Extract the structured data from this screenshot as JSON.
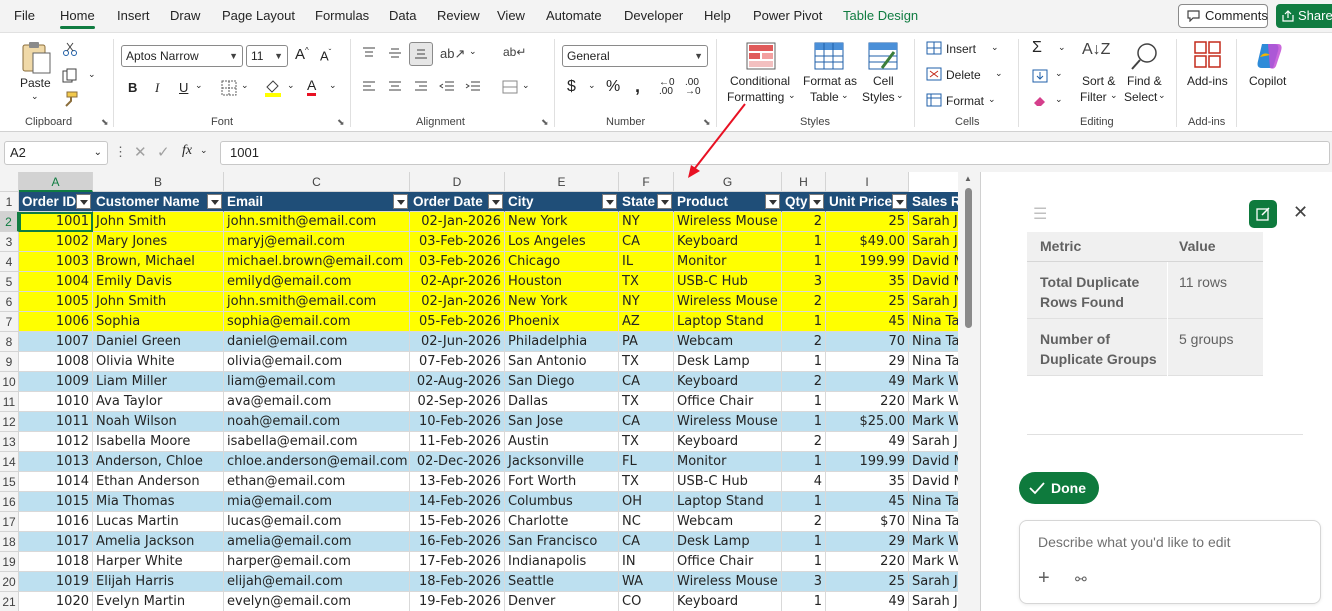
{
  "menu": {
    "items": [
      "File",
      "Home",
      "Insert",
      "Draw",
      "Page Layout",
      "Formulas",
      "Data",
      "Review",
      "View",
      "Automate",
      "Developer",
      "Help",
      "Power Pivot",
      "Table Design"
    ],
    "active": "Home",
    "comments_label": "Comments",
    "share_label": "Share"
  },
  "ribbon": {
    "paste_label": "Paste",
    "font_name": "Aptos Narrow",
    "font_size": "11",
    "number_format": "General",
    "conditional_formatting_line1": "Conditional",
    "conditional_formatting_line2": "Formatting",
    "format_as_table_line1": "Format as",
    "format_as_table_line2": "Table",
    "cell_styles_line1": "Cell",
    "cell_styles_line2": "Styles",
    "insert_label": "Insert",
    "delete_label": "Delete",
    "format_label": "Format",
    "sort_filter_line1": "Sort &",
    "sort_filter_line2": "Filter",
    "find_select_line1": "Find &",
    "find_select_line2": "Select",
    "addins_label": "Add-ins",
    "copilot_label": "Copilot",
    "groups": {
      "clipboard": "Clipboard",
      "font": "Font",
      "alignment": "Alignment",
      "number": "Number",
      "styles": "Styles",
      "cells": "Cells",
      "editing": "Editing",
      "addins": "Add-ins"
    }
  },
  "formula_bar": {
    "name_box": "A2",
    "fx_label": "fx",
    "value": "1001"
  },
  "sheet": {
    "columns": [
      "A",
      "B",
      "C",
      "D",
      "E",
      "F",
      "G",
      "H",
      "I"
    ],
    "headers": [
      "Order ID",
      "Customer Name",
      "Email",
      "Order Date",
      "City",
      "State",
      "Product",
      "Qty",
      "Unit Price",
      "Sales Rep"
    ],
    "rows": [
      [
        "1001",
        "John Smith",
        "john.smith@email.com",
        "02-Jan-2026",
        "New York",
        "NY",
        "Wireless Mouse",
        "2",
        "25",
        "Sarah J"
      ],
      [
        "1002",
        "Mary Jones",
        "maryj@email.com",
        "03-Feb-2026",
        "Los Angeles",
        "CA",
        "Keyboard",
        "1",
        "$49.00",
        "Sarah J"
      ],
      [
        "1003",
        "Brown, Michael",
        "michael.brown@email.com",
        "03-Feb-2026",
        "Chicago",
        "IL",
        "Monitor",
        "1",
        "199.99",
        "David M"
      ],
      [
        "1004",
        "Emily Davis",
        "emilyd@email.com",
        "02-Apr-2026",
        "Houston",
        "TX",
        "USB-C Hub",
        "3",
        "35",
        "David M"
      ],
      [
        "1005",
        "John Smith",
        "john.smith@email.com",
        "02-Jan-2026",
        "New York",
        "NY",
        "Wireless Mouse",
        "2",
        "25",
        "Sarah J"
      ],
      [
        "1006",
        "Sophia",
        "sophia@email.com",
        "05-Feb-2026",
        "Phoenix",
        "AZ",
        "Laptop Stand",
        "1",
        "45",
        "Nina Ta"
      ],
      [
        "1007",
        "Daniel Green",
        "daniel@email.com",
        "02-Jun-2026",
        "Philadelphia",
        "PA",
        "Webcam",
        "2",
        "70",
        "Nina Ta"
      ],
      [
        "1008",
        "Olivia White",
        "olivia@email.com",
        "07-Feb-2026",
        "San Antonio",
        "TX",
        "Desk Lamp",
        "1",
        "29",
        "Nina Ta"
      ],
      [
        "1009",
        "Liam Miller",
        "liam@email.com",
        "02-Aug-2026",
        "San Diego",
        "CA",
        "Keyboard",
        "2",
        "49",
        "Mark W"
      ],
      [
        "1010",
        "Ava Taylor",
        "ava@email.com",
        "02-Sep-2026",
        "Dallas",
        "TX",
        "Office Chair",
        "1",
        "220",
        "Mark W"
      ],
      [
        "1011",
        "Noah Wilson",
        "noah@email.com",
        "10-Feb-2026",
        "San Jose",
        "CA",
        "Wireless Mouse",
        "1",
        "$25.00",
        "Mark W"
      ],
      [
        "1012",
        "Isabella Moore",
        "isabella@email.com",
        "11-Feb-2026",
        "Austin",
        "TX",
        "Keyboard",
        "2",
        "49",
        "Sarah J"
      ],
      [
        "1013",
        "Anderson, Chloe",
        "chloe.anderson@email.com",
        "02-Dec-2026",
        "Jacksonville",
        "FL",
        "Monitor",
        "1",
        "199.99",
        "David M"
      ],
      [
        "1014",
        "Ethan Anderson",
        "ethan@email.com",
        "13-Feb-2026",
        "Fort Worth",
        "TX",
        "USB-C Hub",
        "4",
        "35",
        "David M"
      ],
      [
        "1015",
        "Mia Thomas",
        "mia@email.com",
        "14-Feb-2026",
        "Columbus",
        "OH",
        "Laptop Stand",
        "1",
        "45",
        "Nina Ta"
      ],
      [
        "1016",
        "Lucas Martin",
        "lucas@email.com",
        "15-Feb-2026",
        "Charlotte",
        "NC",
        "Webcam",
        "2",
        "$70",
        "Nina Ta"
      ],
      [
        "1017",
        "Amelia Jackson",
        "amelia@email.com",
        "16-Feb-2026",
        "San Francisco",
        "CA",
        "Desk Lamp",
        "1",
        "29",
        "Mark W"
      ],
      [
        "1018",
        "Harper White",
        "harper@email.com",
        "17-Feb-2026",
        "Indianapolis",
        "IN",
        "Office Chair",
        "1",
        "220",
        "Mark W"
      ],
      [
        "1019",
        "Elijah Harris",
        "elijah@email.com",
        "18-Feb-2026",
        "Seattle",
        "WA",
        "Wireless Mouse",
        "3",
        "25",
        "Sarah J"
      ],
      [
        "1020",
        "Evelyn Martin",
        "evelyn@email.com",
        "19-Feb-2026",
        "Denver",
        "CO",
        "Keyboard",
        "1",
        "49",
        "Sarah J"
      ]
    ],
    "highlight_rows": 6,
    "row_numbers": [
      "1",
      "2",
      "3",
      "4",
      "5",
      "6",
      "7",
      "8",
      "9",
      "10",
      "11",
      "12",
      "13",
      "14",
      "15",
      "16",
      "17",
      "18",
      "19",
      "20",
      "21"
    ],
    "colors": {
      "header_fill": "#1f4e78",
      "duplicate_fill": "#ffff00",
      "band_fill": "#bde0f0",
      "accent": "#107c41"
    }
  },
  "copilot_panel": {
    "table_header_metric": "Metric",
    "table_header_value": "Value",
    "row1_metric_line1": "Total Duplicate",
    "row1_metric_line2": "Rows Found",
    "row1_value": "11 rows",
    "row2_metric_line1": "Number of",
    "row2_metric_line2": "Duplicate Groups",
    "row2_value": "5 groups",
    "done_label": "Done",
    "prompt_placeholder": "Describe what you'd like to edit"
  }
}
